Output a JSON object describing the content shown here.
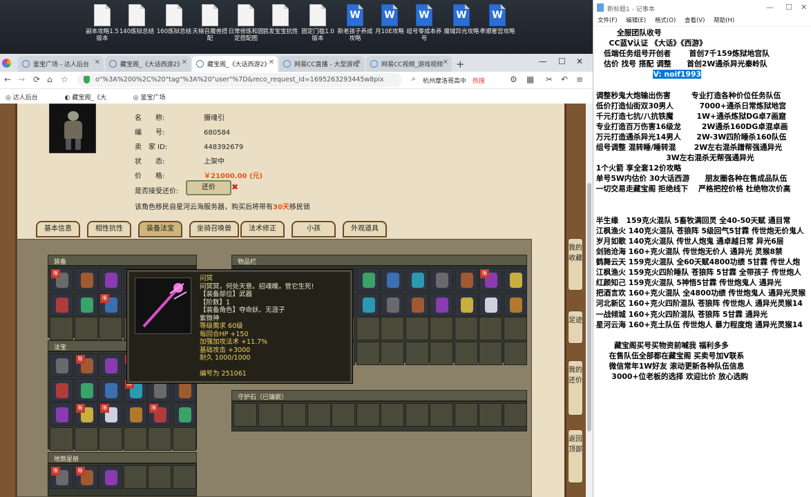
{
  "desktop": {
    "icons": [
      "副本攻略1.5版本",
      "140炼狱总结",
      "160炼狱总结",
      "天梯召魔兽搭配",
      "日常修炼和固定搭配图",
      "首发宝宝抗性",
      "固定门槛1.0版本",
      "新老孩子养成攻略",
      "月10E攻略",
      "组号零成本养号",
      "魔域异光攻略",
      "孝顺奢宫攻略"
    ]
  },
  "browser": {
    "tabs": [
      "鉴宝广场 - 达人后台",
      "藏宝阁_《大话西游2》",
      "藏宝阁_《大话西游2》",
      "网易CC直播 - 大型游戏",
      "网易CC视频_游戏视频"
    ],
    "url": "o\"%3A%200%2C%20\"tag\"%3A%20\"user\"%7D&reco_request_id=1695263293445w8pix",
    "search": "杭州摩洛哥高中",
    "hot": "热搜",
    "bookmarks": [
      "达人后台",
      "藏宝阁_《大",
      "鉴宝广场"
    ]
  },
  "role": {
    "rows": [
      {
        "k": "名　　称:",
        "v": "摄魂引"
      },
      {
        "k": "编　　号:",
        "v": "680584"
      },
      {
        "k": "卖　家 ID:",
        "v": "448392679"
      },
      {
        "k": "状　　态:",
        "v": "上架中"
      },
      {
        "k": "价　　格:",
        "v": "￥21000.00 (元)"
      }
    ],
    "accept": "是否接受还价:",
    "haggle": "还价",
    "notice_pre": "该角色移民自星河云海服务器，购买后将带有",
    "notice_days": "30天",
    "notice_post": "移民锁"
  },
  "gameTabs": [
    "基本信息",
    "相性抗性",
    "装备法宝",
    "坐骑召唤兽",
    "法术修正",
    "小孩",
    "外观道具"
  ],
  "panels": {
    "equip": "装备",
    "items": "物品栏",
    "fabao": "法宝",
    "guard": "守护石（已镶嵌）",
    "stone": "地煞星册"
  },
  "badge": "限",
  "tooltip": {
    "lines": [
      "问冥",
      "问冥冥，何处天意。招魂魄，管它生死!",
      "【装备部位】武器",
      "【阶数】1",
      "【装备角色】夺命妖、无涯子",
      "紫微神",
      "等级需求 60级",
      "每回合HP +150",
      "加强加攻法术 +11.7%",
      "基础攻击 +3000",
      "耐久 1000/1000",
      "",
      "编号为 251061"
    ],
    "colors": [
      "#e8d070",
      "#e8e4c8",
      "#e8e4c8",
      "#e8e4c8",
      "#e8e4c8",
      "#e8e4c8",
      "#f0d060",
      "#f0d060",
      "#f0d060",
      "#f0d060",
      "#f0d060",
      "",
      "#f0d060"
    ]
  },
  "sideButtons": [
    "我的收藏",
    "足迹",
    "我的还价",
    "返回顶部"
  ],
  "notepad": {
    "title": "新标题1 - 记事本",
    "menu": [
      "文件(F)",
      "编辑(E)",
      "格式(O)",
      "查看(V)",
      "帮助(H)"
    ],
    "lines": [
      "         全服团队收号",
      "      CC蓝V认证 《大话》《西游》",
      "    低端任务组号开创者       首创7千159炼狱地宫队",
      "    估价 找号 搭配 调整      首创2W通杀异光秦岭队",
      "                       V: noif1993",
      "",
      " 调整秒鬼大炮输出伤害        专业打造各种价位任务队伍",
      " 低价打造仙街双30男人          7000+通杀日常炼狱地宫",
      " 千元打造七抗/八抗铁魔         1W+通杀炼狱DG卓7画窟",
      " 专业打造百万伤害16级龙        2W通杀160DG卓混卓画",
      " 万元打造通杀异光14男人      2W-3W四阶睡杀160队伍",
      " 组号调整 混转睡/睡转混       2W左右混杀蹭帮强通异光",
      "                            3W左右混杀无帮强通异光",
      " 1个火箭 享全套12价攻略",
      " 单号5W内估价 30大话西游      朋友圈各种在售成品队伍",
      " 一切交易走藏宝阁 拒绝线下    严格把控价格 杜绝物次价高",
      "",
      "",
      " 半生缘   159克火混队 5畜牧满回灵 全40-50天赋 通目常",
      " 江枫渔火 140克火混队 苍狼阵 5级回气5甘霖 传世炮无价鬼人",
      " 岁月如歌 140克火混队 传世人炮鬼 通卓越日常 异光6层",
      " 剑驰沧海 160+克火混队 传世炮无价人 通异光 灵猴8禁",
      " 鹤舞云天 159克火混队 全60天赋4800功绩 5甘霖 传世人炮",
      " 江枫渔火 159克火四阶睡队 苍狼阵 5甘霖 全带孩子 传世炮人",
      " 红颜知己 159克火混队 5神悟5甘霖 传世炮鬼人 通异光",
      " 把酒言欢 160+克火混队 全4800功绩 传世炮鬼人 通异光灵猴",
      " 河北新区 160+克火四阶混队 苍狼阵 传世炮人 通异光灵猴14",
      " 一战倾城 160+克火四阶混队 苍狼阵 5甘霖 通异光",
      " 星河云海 160+克土队伍 传世炮人 暴力程度炮 通异光灵猴14",
      "",
      "        藏宝阁买号买物资前喊我 福利多多",
      "      在售队伍全部都在藏宝阁 买卖号加V联系",
      "      微信常年1W好友 滚动更新各种队伍信息",
      "       3000+位老板的选择 欢迎比价 放心选购"
    ]
  }
}
